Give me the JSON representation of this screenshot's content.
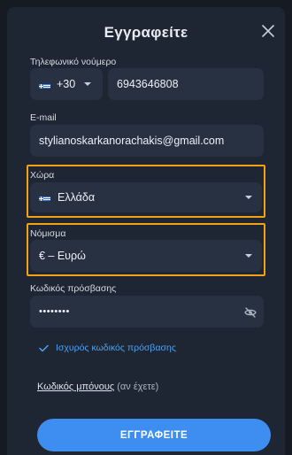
{
  "modal": {
    "title": "Εγγραφείτε"
  },
  "phone": {
    "label": "Τηλεφωνικό νούμερο",
    "country_code": "+30",
    "value": "6943646808"
  },
  "email": {
    "label": "E-mail",
    "value": "stylianoskarkanorachakis@gmail.com"
  },
  "country": {
    "label": "Χώρα",
    "value": "Ελλάδα"
  },
  "currency": {
    "label": "Νόμισμα",
    "value": "€ – Ευρώ"
  },
  "password": {
    "label": "Κωδικός πρόσβασης",
    "value": "••••••••",
    "strength_text": "Ισχυρός κωδικός πρόσβασης"
  },
  "bonus": {
    "link_text": "Κωδικός μπόνους",
    "suffix": " (αν έχετε)"
  },
  "submit": {
    "label": "ΕΓΓΡΑΦΕΙΤΕ"
  },
  "colors": {
    "accent": "#3d8ef0",
    "highlight": "#f5a118",
    "strength": "#4da3f0",
    "field_bg": "#283142",
    "modal_bg": "#1e2533"
  },
  "icons": {
    "close": "close-icon",
    "flag": "greece-flag-icon",
    "caret": "chevron-down-icon",
    "eye": "eye-off-icon",
    "check": "check-icon"
  }
}
